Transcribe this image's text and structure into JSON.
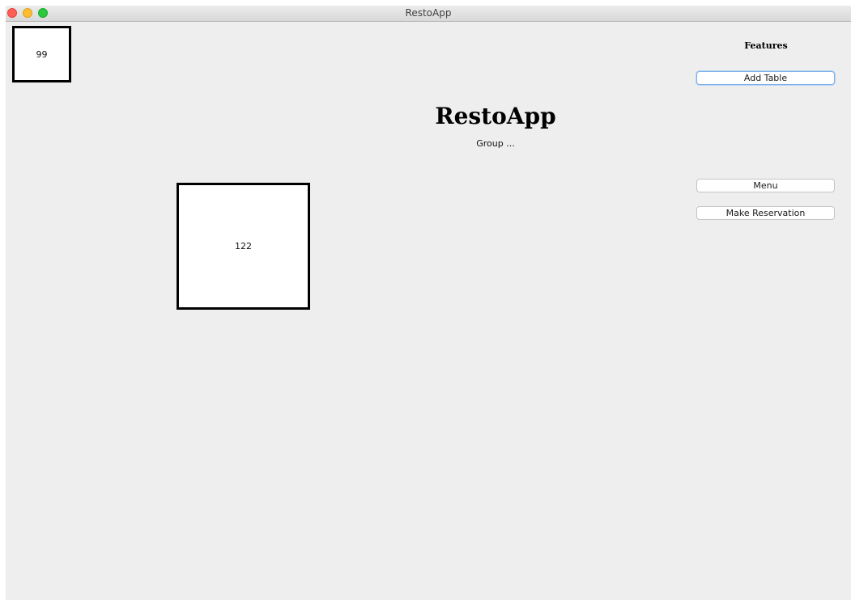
{
  "window": {
    "title": "RestoApp"
  },
  "tables": [
    {
      "number": "99"
    },
    {
      "number": "122"
    }
  ],
  "header": {
    "title": "RestoApp",
    "subtitle": "Group ..."
  },
  "features": {
    "title": "Features",
    "add_table_label": "Add Table",
    "menu_label": "Menu",
    "make_reservation_label": "Make Reservation"
  },
  "colors": {
    "close": "#ff5f57",
    "minimize": "#febc2e",
    "zoom": "#28c840",
    "background": "#eeeeee",
    "focus_ring": "#7fb1e8"
  }
}
